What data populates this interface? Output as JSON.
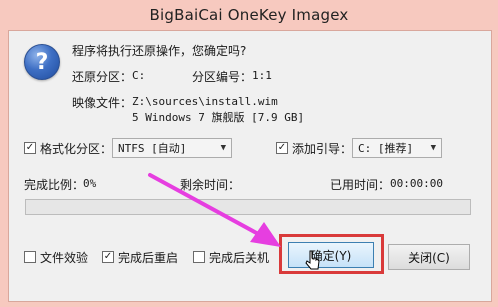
{
  "window": {
    "title": "BigBaiCai OneKey Imagex"
  },
  "dialog": {
    "question": "程序将执行还原操作，您确定吗?",
    "restore_partition_label": "还原分区：",
    "restore_partition_value": "C:",
    "partition_number_label": "分区编号：",
    "partition_number_value": "1:1",
    "image_file_label": "映像文件：",
    "image_file_path": "Z:\\sources\\install.wim",
    "image_file_desc": "5 Windows 7 旗舰版 [7.9 GB]"
  },
  "options": {
    "format_partition": {
      "label": "格式化分区：",
      "checked": true,
      "select_value": "NTFS [自动]"
    },
    "add_boot": {
      "label": "添加引导：",
      "checked": true,
      "select_value": "C: [推荐]"
    }
  },
  "progress": {
    "ratio_label": "完成比例：",
    "ratio_value": "0%",
    "remaining_label": "剩余时间：",
    "remaining_value": "",
    "elapsed_label": "已用时间：",
    "elapsed_value": "00:00:00",
    "fraction": 0
  },
  "bottom_options": [
    {
      "label": "文件效验",
      "checked": false
    },
    {
      "label": "完成后重启",
      "checked": true
    },
    {
      "label": "完成后关机",
      "checked": false
    }
  ],
  "buttons": {
    "confirm": "确定(Y)",
    "close": "关闭(C)"
  },
  "colors": {
    "title_bar": "#f7c9bf",
    "highlight_box": "#d93a3a",
    "annotation_arrow": "#e63ee0",
    "question_icon": "#3e6fc4"
  }
}
